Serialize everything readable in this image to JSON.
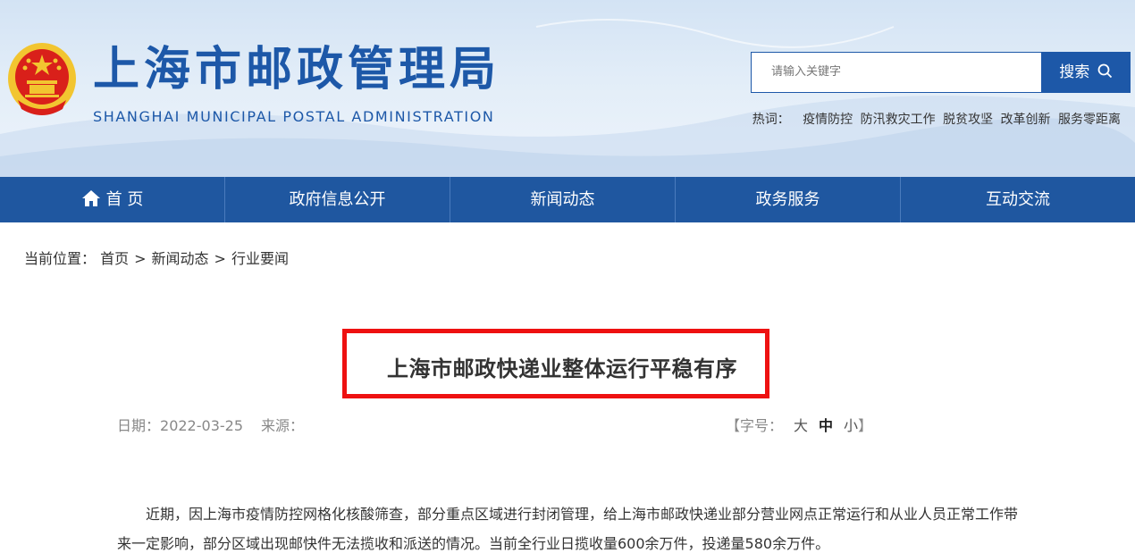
{
  "header": {
    "site_title": "上海市邮政管理局",
    "site_subtitle": "SHANGHAI MUNICIPAL POSTAL ADMINISTRATION",
    "search": {
      "placeholder": "请输入关键字",
      "button_label": "搜索"
    },
    "hotwords": {
      "label": "热词：",
      "items": [
        "疫情防控",
        "防汛救灾工作",
        "脱贫攻坚",
        "改革创新",
        "服务零距离"
      ]
    }
  },
  "nav": {
    "items": [
      "首 页",
      "政府信息公开",
      "新闻动态",
      "政务服务",
      "互动交流"
    ]
  },
  "breadcrumb": {
    "label": "当前位置：",
    "items": [
      "首页",
      "新闻动态",
      "行业要闻"
    ],
    "separator": ">"
  },
  "article": {
    "title": "上海市邮政快递业整体运行平稳有序",
    "date_label": "日期：",
    "date": "2022-03-25",
    "source_label": "来源：",
    "font_size_label": "【字号：",
    "font_sizes": [
      "大",
      "中",
      "小"
    ],
    "font_size_close": "】",
    "paragraph": "近期，因上海市疫情防控网格化核酸筛查，部分重点区域进行封闭管理，给上海市邮政快递业部分营业网点正常运行和从业人员正常工作带来一定影响，部分区域出现邮快件无法揽收和派送的情况。当前全行业日揽收量600余万件，投递量580余万件。"
  },
  "colors": {
    "brand_blue": "#1d58a8",
    "nav_blue": "#1f57a0",
    "highlight_red": "#ee1111",
    "emblem_red": "#d9201a",
    "emblem_gold": "#f2c530"
  }
}
